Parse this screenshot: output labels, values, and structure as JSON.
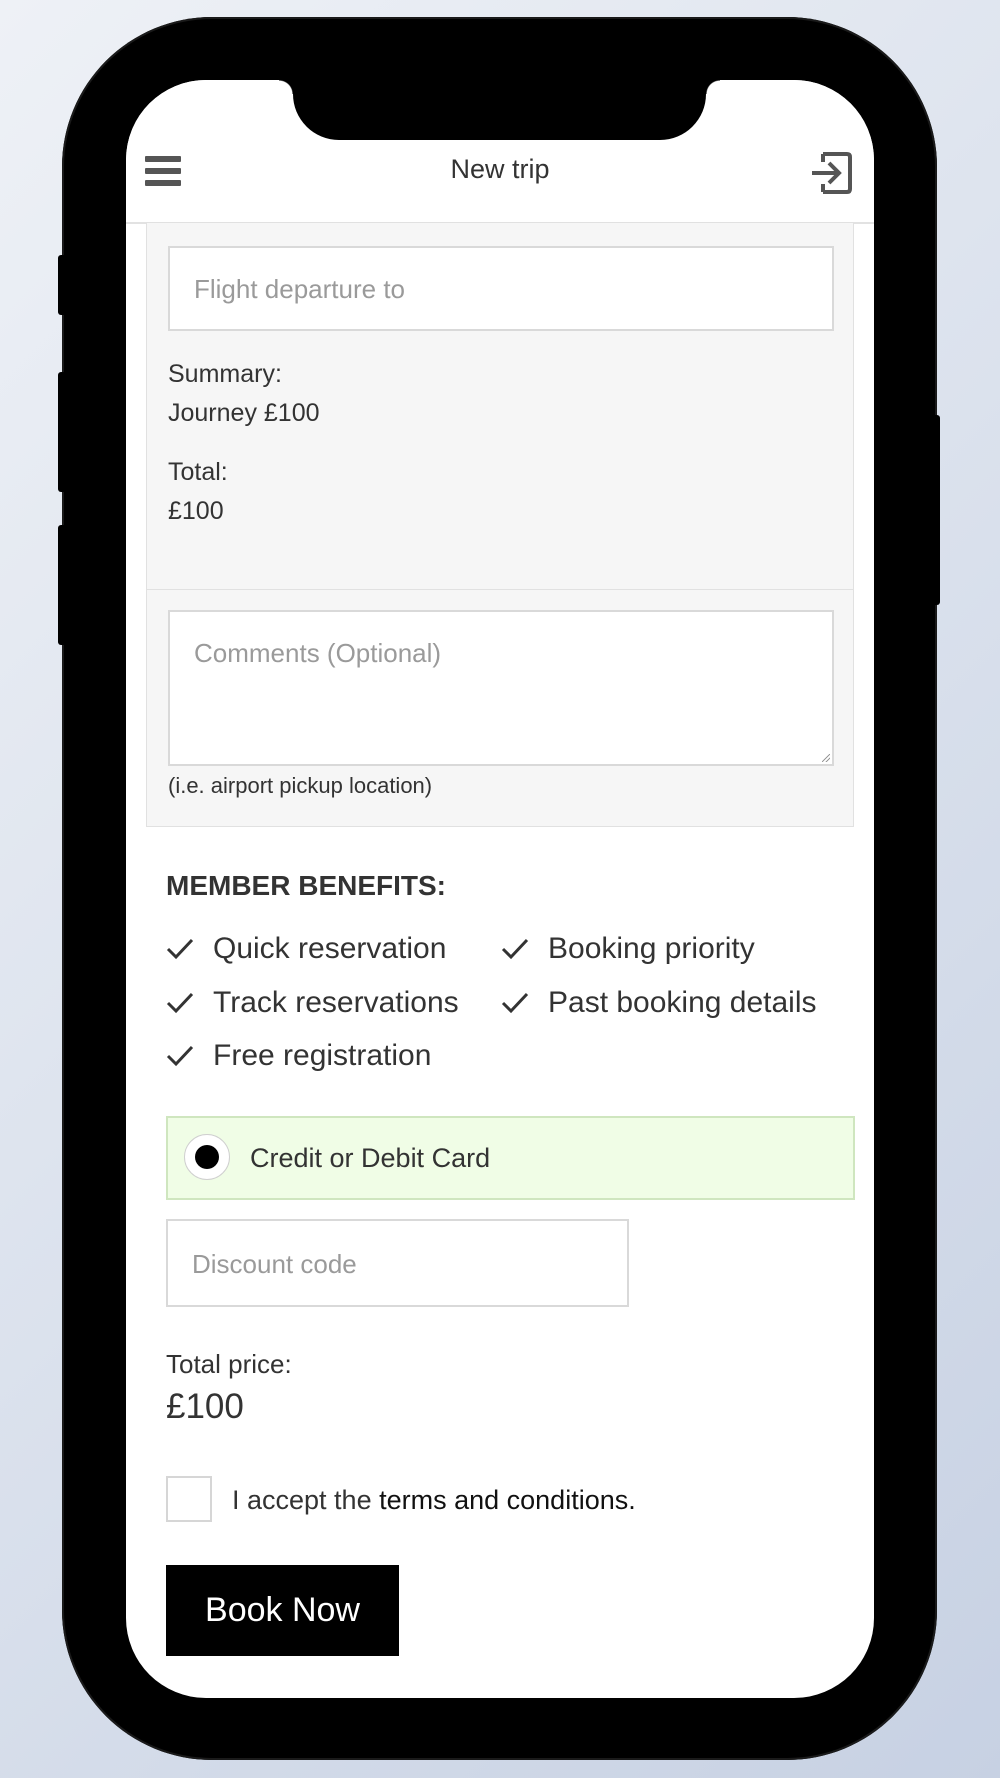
{
  "header": {
    "title": "New trip",
    "menu_icon": "hamburger-menu-icon",
    "logout_icon": "sign-out-icon"
  },
  "trip": {
    "flight_departure_placeholder": "Flight departure to",
    "summary_label": "Summary:",
    "summary_value": "Journey £100",
    "total_label": "Total:",
    "total_value": "£100"
  },
  "comments": {
    "placeholder": "Comments (Optional)",
    "hint": "(i.e. airport pickup location)"
  },
  "benefits": {
    "title": "MEMBER BENEFITS:",
    "items": [
      "Quick reservation",
      "Booking priority",
      "Track reservations",
      "Past booking details",
      "Free registration"
    ]
  },
  "payment": {
    "option_label": "Credit or Debit Card",
    "selected": true,
    "highlight_color": "#f0fde6"
  },
  "discount": {
    "placeholder": "Discount code"
  },
  "price": {
    "label": "Total price:",
    "value": "£100"
  },
  "terms": {
    "prefix": "I accept the ",
    "link_text": "terms and conditions.",
    "checked": false
  },
  "actions": {
    "book_label": "Book Now"
  }
}
